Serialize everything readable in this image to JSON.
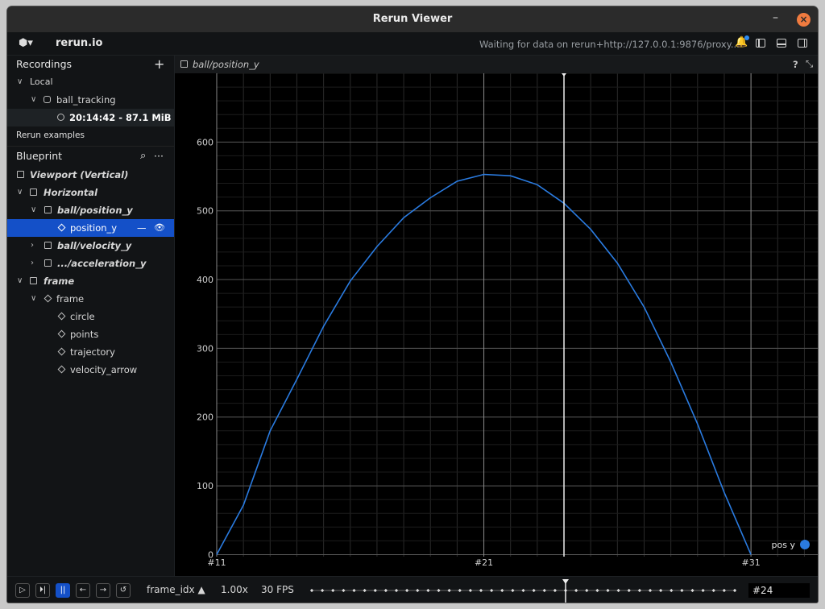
{
  "window": {
    "title": "Rerun Viewer",
    "minimize": "–",
    "close": "×"
  },
  "topbar": {
    "logo_icon": "rerun-logo-icon",
    "logo": "⬢▾",
    "app_name": "rerun.io",
    "status": "Waiting for data on rerun+http://127.0.0.1:9876/proxy...",
    "bell": "🔔"
  },
  "recordings": {
    "title": "Recordings",
    "add": "+",
    "local_label": "Local",
    "app_id": "ball_tracking",
    "recording": "20:14:42 - 87.1 MiB",
    "examples": "Rerun examples"
  },
  "blueprint": {
    "title": "Blueprint",
    "search": "⌕",
    "more": "···",
    "items": [
      {
        "label": "Viewport (Vertical)",
        "italic": true
      },
      {
        "label": "Horizontal",
        "italic": true
      },
      {
        "label": "ball/position_y",
        "italic": true
      },
      {
        "label": "position_y",
        "italic": false
      },
      {
        "label": "ball/velocity_y",
        "italic": true
      },
      {
        "label": ".../acceleration_y",
        "italic": true
      },
      {
        "label": "frame",
        "italic": true
      },
      {
        "label": "frame",
        "italic": false
      },
      {
        "label": "circle",
        "italic": false
      },
      {
        "label": "points",
        "italic": false
      },
      {
        "label": "trajectory",
        "italic": false
      },
      {
        "label": "velocity_arrow",
        "italic": false
      }
    ],
    "selected_remove": "—",
    "selected_visible": "👁"
  },
  "view": {
    "tab_title": "ball/position_y",
    "help": "?",
    "collapse": "⤡"
  },
  "chart_data": {
    "type": "line",
    "x": [
      11,
      12,
      13,
      14,
      15,
      16,
      17,
      18,
      19,
      20,
      21,
      22,
      23,
      24,
      25,
      26,
      27,
      28,
      29,
      30,
      31
    ],
    "series": [
      {
        "name": "pos y",
        "color": "#2a7be0",
        "values": [
          0,
          72,
          180,
          255,
          332,
          398,
          448,
          490,
          519,
          543,
          553,
          551,
          538,
          511,
          473,
          424,
          360,
          280,
          190,
          90,
          0
        ]
      }
    ],
    "y_ticks": [
      0,
      100,
      200,
      300,
      400,
      500,
      600
    ],
    "x_ticks": [
      "#11",
      "#21",
      "#31"
    ],
    "xlim": [
      11,
      33.5
    ],
    "ylim": [
      -3,
      700
    ],
    "cursor_x": 24,
    "legend": "bottom-right",
    "grid": true
  },
  "timeline": {
    "play": "▷",
    "step": "⏵|",
    "pause": "||",
    "back": "←",
    "forward": "→",
    "loop": "↺",
    "timeline_name": "frame_idx ▲",
    "speed": "1.00x",
    "fps": "30 FPS",
    "current_frame": "#24",
    "current_index": 24,
    "frame_min": 0,
    "frame_max": 40
  }
}
